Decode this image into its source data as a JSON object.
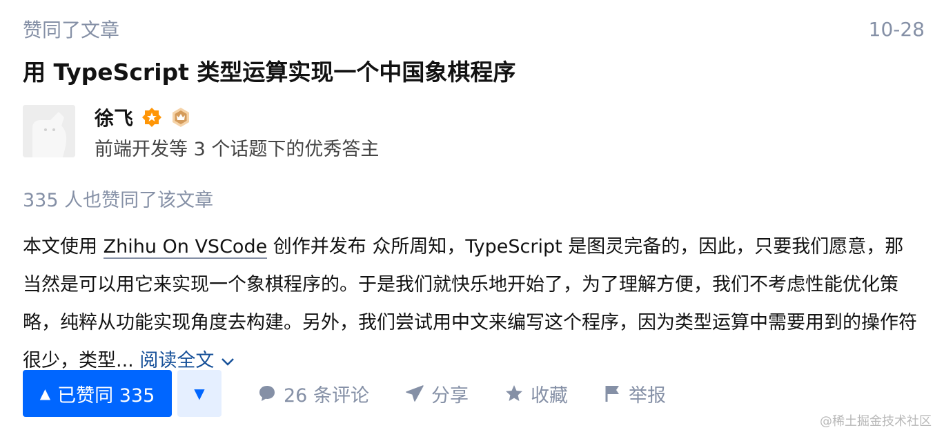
{
  "card": {
    "action_label": "赞同了文章",
    "date": "10-28",
    "title": "用 TypeScript 类型运算实现一个中国象棋程序"
  },
  "author": {
    "name": "徐飞",
    "headline": "前端开发等 3 个话题下的优秀答主"
  },
  "voters_text": "335 人也赞同了该文章",
  "excerpt": {
    "prefix": "本文使用 ",
    "link_text": "Zhihu On VSCode",
    "body": " 创作并发布 众所周知，TypeScript 是图灵完备的，因此，只要我们愿意，那当然是可以用它来实现一个象棋程序的。于是我们就快乐地开始了，为了理解方便，我们不考虑性能优化策略，纯粹从功能实现角度去构建。另外，我们尝试用中文来编写这个程序，因为类型运算中需要用到的操作符很少，类型...",
    "read_more": "阅读全文"
  },
  "actions": {
    "vote_up": "已赞同 335",
    "comments": "26 条评论",
    "share": "分享",
    "favorite": "收藏",
    "report": "举报"
  },
  "watermark": "@稀土掘金技术社区",
  "colors": {
    "accent": "#0066ff",
    "muted": "#8590a6",
    "link": "#175199"
  }
}
